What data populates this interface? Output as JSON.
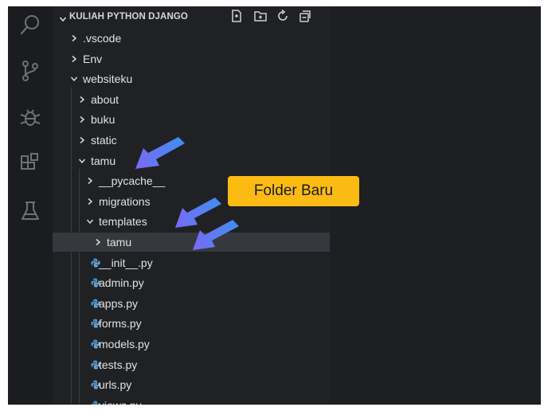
{
  "explorer": {
    "section_title": "KULIAH PYTHON DJANGO",
    "header_actions": [
      "new-file",
      "new-folder",
      "refresh",
      "collapse-all"
    ],
    "tree": [
      {
        "label": ".vscode",
        "type": "folder",
        "expanded": false,
        "depth": 0
      },
      {
        "label": "Env",
        "type": "folder",
        "expanded": false,
        "depth": 0
      },
      {
        "label": "websiteku",
        "type": "folder",
        "expanded": true,
        "depth": 0
      },
      {
        "label": "about",
        "type": "folder",
        "expanded": false,
        "depth": 1
      },
      {
        "label": "buku",
        "type": "folder",
        "expanded": false,
        "depth": 1
      },
      {
        "label": "static",
        "type": "folder",
        "expanded": false,
        "depth": 1
      },
      {
        "label": "tamu",
        "type": "folder",
        "expanded": true,
        "depth": 1
      },
      {
        "label": "__pycache__",
        "type": "folder",
        "expanded": false,
        "depth": 2
      },
      {
        "label": "migrations",
        "type": "folder",
        "expanded": false,
        "depth": 2
      },
      {
        "label": "templates",
        "type": "folder",
        "expanded": true,
        "depth": 2
      },
      {
        "label": "tamu",
        "type": "folder",
        "expanded": false,
        "depth": 3,
        "selected": true
      },
      {
        "label": "__init__.py",
        "type": "python-file",
        "depth": 2
      },
      {
        "label": "admin.py",
        "type": "python-file",
        "depth": 2
      },
      {
        "label": "apps.py",
        "type": "python-file",
        "depth": 2
      },
      {
        "label": "forms.py",
        "type": "python-file",
        "depth": 2
      },
      {
        "label": "models.py",
        "type": "python-file",
        "depth": 2
      },
      {
        "label": "tests.py",
        "type": "python-file",
        "depth": 2
      },
      {
        "label": "urls.py",
        "type": "python-file",
        "depth": 2
      },
      {
        "label": "views.py",
        "type": "python-file",
        "depth": 2
      }
    ]
  },
  "activity_bar": [
    "search-icon",
    "source-control-icon",
    "debug-icon",
    "extensions-icon",
    "testing-icon"
  ],
  "annotation": {
    "callout_text": "Folder Baru",
    "arrow_count": 3
  },
  "colors": {
    "background": "#1e1f22",
    "sidebar": "#202124",
    "selected_row": "#37383d",
    "text": "#e2e2e2",
    "python_icon": "#4f8fbf",
    "callout": "#fbbb13",
    "arrow": "#5b7bf2"
  }
}
